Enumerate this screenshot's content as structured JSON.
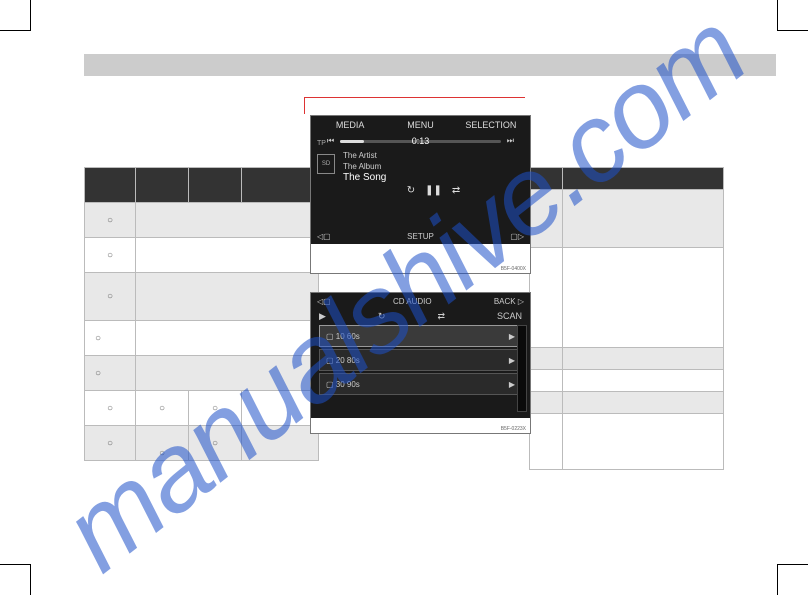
{
  "watermark": "manualshive.com",
  "media_player": {
    "top_tabs": {
      "left": "MEDIA",
      "center": "MENU",
      "right": "SELECTION"
    },
    "tp_label": "TP",
    "prev_glyph": "⏮",
    "time": "0:13",
    "next_glyph": "⏭",
    "sd_label": "SD",
    "artist": "The Artist",
    "album": "The Album",
    "song": "The Song",
    "controls": {
      "repeat": "↻",
      "pause": "❚❚",
      "shuffle": "⇄"
    },
    "bottom": {
      "left_icon": "◁▢",
      "label": "SETUP",
      "right_icon": "▢▷"
    },
    "code": "B5F-0400X"
  },
  "folder_browser": {
    "top": {
      "left_icon": "◁▢",
      "title": "CD AUDIO",
      "right": "BACK ▷"
    },
    "icon_row": {
      "play": "▶",
      "repeat": "↻",
      "shuffle": "⇄",
      "scan": "SCAN"
    },
    "rows": [
      {
        "label": "10 60s",
        "play": "▶"
      },
      {
        "label": "20 80s",
        "play": "▶"
      },
      {
        "label": "30 90s",
        "play": "▶"
      }
    ],
    "code": "B5F-0223X"
  },
  "circle": "○"
}
